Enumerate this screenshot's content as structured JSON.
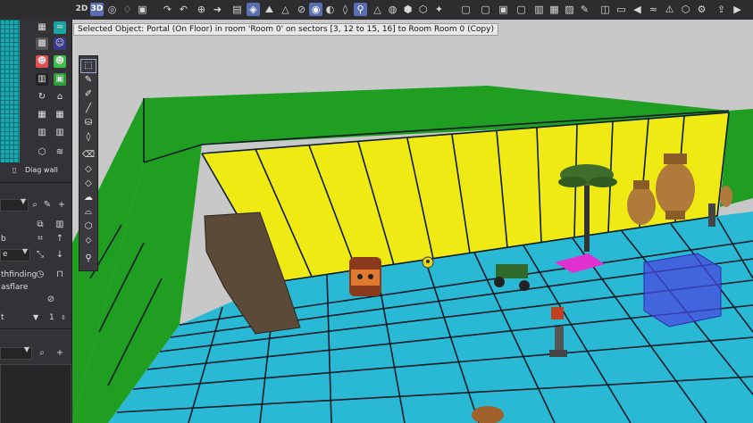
{
  "toolbar": {
    "mode_2d": "2D",
    "mode_3d": "3D",
    "icons": [
      "2d-toggle",
      "3d-toggle",
      "sphere-icon",
      "light-icon",
      "camera-icon",
      "redo-icon",
      "crosshair-icon",
      "arrow-icon",
      "lock-icon",
      "texture-icon",
      "mountain-icon",
      "geometry-icon",
      "target-icon",
      "circle-fill-icon",
      "drop-icon",
      "lamp-icon",
      "triangle-icon",
      "palette-icon",
      "fx-icon",
      "cube-icon",
      "effects-icon",
      "cursor-icon"
    ],
    "colors": {
      "background": "#2d2d30",
      "active": "#5a6fb0",
      "icon": "#d8d8d8"
    }
  },
  "status": {
    "selected_text": "Selected Object: Portal (On Floor) in room 'Room 0' on sectors [3, 12 to 15, 16] to Room Room 0 (Copy)"
  },
  "left_panel": {
    "diag_wall_label": "Diag wall",
    "list_items": [
      "b",
      "e",
      "thfinding",
      "asflare",
      "t"
    ],
    "spinner_value": "1",
    "colors": {
      "map_grid": "#18a8b0",
      "red_icon": "#e05050",
      "green_icon": "#3bbf4a",
      "teal_icon": "#1aa3a0"
    }
  },
  "tools": [
    "selection-tool",
    "brush-tool",
    "pencil-tool",
    "line-tool",
    "bucket-tool",
    "drop-tool",
    "eraser-tool",
    "paint-tool",
    "shape-tool",
    "cloud-tool",
    "cut-tool",
    "geometry-tool",
    "diamond-tool",
    "probe-tool"
  ],
  "scene": {
    "colors": {
      "wall_green": "#1f9e22",
      "wall_yellow": "#f0ea14",
      "floor": "#29b9d5",
      "grid_line": "#0b1b25",
      "sky": "#c8c8c8",
      "portal": "#e030d0",
      "cube": "#4a4adf"
    },
    "objects": [
      "rock-pile",
      "barrel-face",
      "quad-bike",
      "palm-tree",
      "urn-large",
      "urn-small",
      "statue",
      "portal-marker",
      "blue-cube",
      "waypoint-marker"
    ]
  }
}
